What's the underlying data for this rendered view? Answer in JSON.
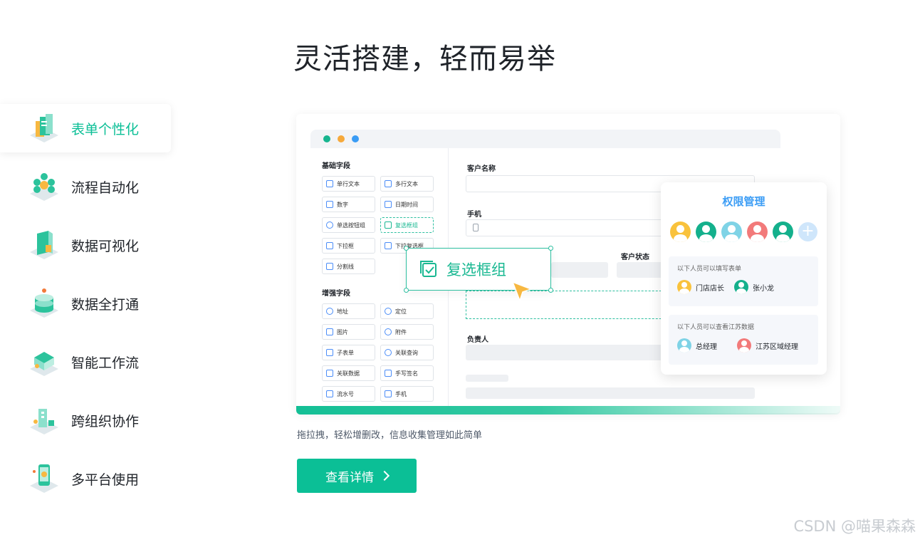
{
  "page": {
    "title": "灵活搭建，轻而易举",
    "caption": "拖拉拽，轻松增删改，信息收集管理如此简单",
    "cta_label": "查看详情",
    "watermark": "CSDN @喵果森森",
    "accent_color": "#0bbf96"
  },
  "nav": {
    "items": [
      {
        "label": "表单个性化",
        "icon": "form-icon",
        "active": true
      },
      {
        "label": "流程自动化",
        "icon": "workflow-icon",
        "active": false
      },
      {
        "label": "数据可视化",
        "icon": "chart-icon",
        "active": false
      },
      {
        "label": "数据全打通",
        "icon": "database-icon",
        "active": false
      },
      {
        "label": "智能工作流",
        "icon": "automation-icon",
        "active": false
      },
      {
        "label": "跨组织协作",
        "icon": "collaboration-icon",
        "active": false
      },
      {
        "label": "多平台使用",
        "icon": "multi-platform-icon",
        "active": false
      }
    ]
  },
  "builder": {
    "basic_title": "基础字段",
    "basic_fields": [
      "单行文本",
      "多行文本",
      "数字",
      "日期时间",
      "单选按钮组",
      "复选框组",
      "下拉框",
      "下拉复选框",
      "分割线"
    ],
    "advanced_title": "增强字段",
    "advanced_fields": [
      "地址",
      "定位",
      "图片",
      "附件",
      "子表单",
      "关联查询",
      "关联数据",
      "手写签名",
      "流水号",
      "手机"
    ],
    "form_labels": {
      "customer_name": "客户名称",
      "phone": "手机",
      "customer_status": "客户状态",
      "owner": "负责人"
    },
    "dragging_chip": "复选框组"
  },
  "permission": {
    "title": "权限管理",
    "avatar_colors": [
      "#f9c23c",
      "#14b08c",
      "#7fd3e6",
      "#f27a7a",
      "#14b08c"
    ],
    "fill_group": {
      "title": "以下人员可以填写表单",
      "people": [
        {
          "name": "门店店长",
          "color": "#f9c23c"
        },
        {
          "name": "张小龙",
          "color": "#14b08c"
        }
      ]
    },
    "view_group": {
      "title": "以下人员可以查看江苏数据",
      "people": [
        {
          "name": "总经理",
          "color": "#7fd3e6"
        },
        {
          "name": "江苏区域经理",
          "color": "#f27a7a"
        }
      ]
    }
  }
}
